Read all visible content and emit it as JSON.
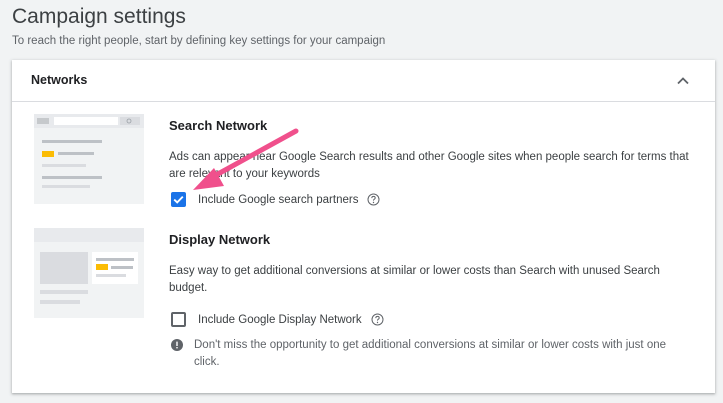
{
  "page": {
    "title": "Campaign settings",
    "subtitle": "To reach the right people, start by defining key settings for your campaign"
  },
  "networks": {
    "title": "Networks",
    "search": {
      "title": "Search Network",
      "description": "Ads can appear near Google Search results and other Google sites when people search for terms that are relevant to your keywords",
      "checkbox_label": "Include Google search partners",
      "checked": true
    },
    "display": {
      "title": "Display Network",
      "description": "Easy way to get additional conversions at similar or lower costs than Search with unused Search budget.",
      "checkbox_label": "Include Google Display Network",
      "checked": false,
      "info": "Don't miss the opportunity to get additional conversions at similar or lower costs with just one click."
    }
  },
  "colors": {
    "accent": "#1a73e8",
    "highlight": "#fbbc04",
    "annotation_arrow": "#f0508c"
  },
  "icons": [
    "chevron-up-icon",
    "help-icon",
    "info-icon",
    "check-icon"
  ]
}
